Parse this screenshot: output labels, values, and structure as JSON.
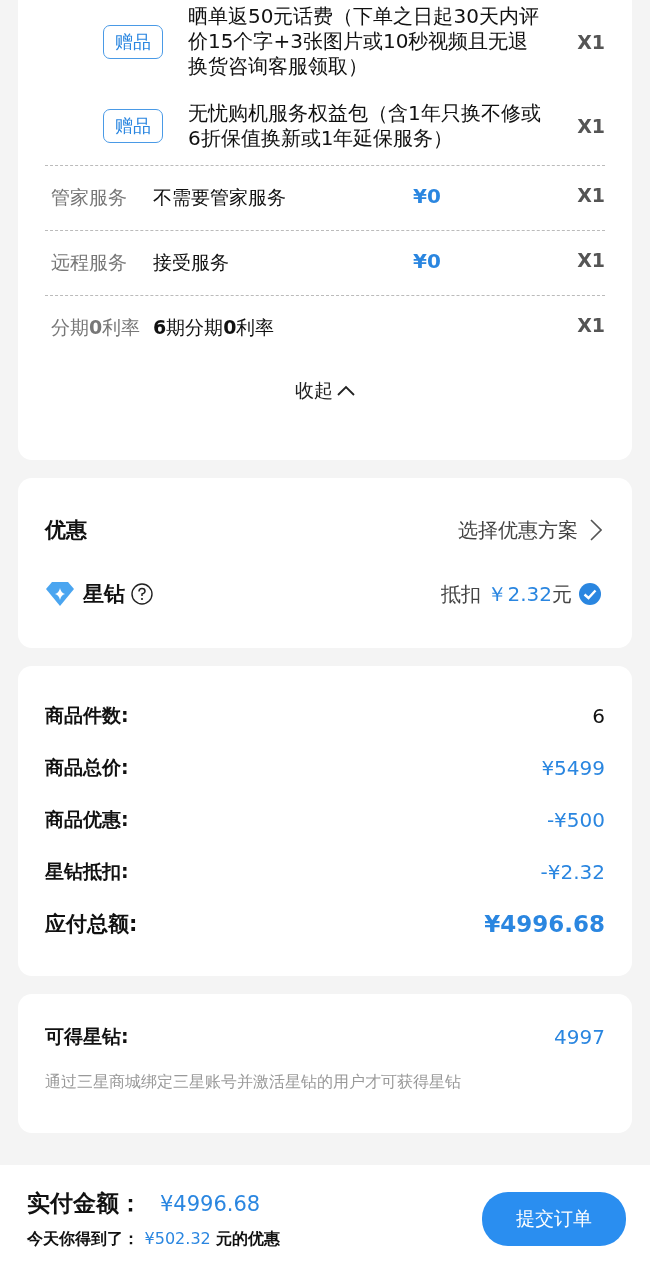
{
  "gifts": [
    {
      "badge": "赠品",
      "text": "晒单返50元话费（下单之日起30天内评价15个字+3张图片或10秒视频且无退换货咨询客服领取）",
      "quantity": "X1"
    },
    {
      "badge": "赠品",
      "text": "无忧购机服务权益包（含1年只换不修或6折保值换新或1年延保服务）",
      "quantity": "X1"
    }
  ],
  "services": [
    {
      "label": "管家服务",
      "value": "不需要管家服务",
      "price": "¥0",
      "quantity": "X1"
    },
    {
      "label": "远程服务",
      "value": "接受服务",
      "price": "¥0",
      "quantity": "X1"
    },
    {
      "label": "分期**0**利率",
      "value": "**6**期分期**0**利率",
      "quantity": "X1"
    }
  ],
  "collapse": "收起",
  "discount": {
    "title": "优惠",
    "action": "选择优惠方案",
    "item": {
      "name": "星钻",
      "deduction_label": "抵扣",
      "amount": "￥2.32",
      "unit": "元",
      "checked": true
    }
  },
  "summary": [
    {
      "label": "商品件数:",
      "value": "6",
      "kind": "count"
    },
    {
      "label": "商品总价:",
      "value": "¥5499",
      "kind": "money"
    },
    {
      "label": "商品优惠:",
      "value": "-¥500",
      "kind": "money"
    },
    {
      "label": "星钻抵扣:",
      "value": "-¥2.32",
      "kind": "money"
    },
    {
      "label": "应付总额:",
      "value": "¥4996.68",
      "kind": "total"
    }
  ],
  "rewards": {
    "label": "可得星钻:",
    "value": "4997",
    "note": "通过三星商城绑定三星账号并激活星钻的用户才可获得星钻"
  },
  "footer": {
    "label": "实付金额：",
    "amount": "¥4996.68",
    "saving_prefix": "今天你得到了：",
    "saving_amount": "¥502.32",
    "saving_suffix": "元的优惠",
    "submit": "提交订单"
  }
}
